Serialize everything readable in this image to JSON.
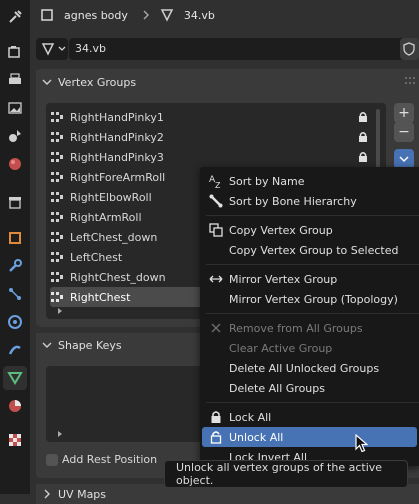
{
  "header": {
    "object_name": "agnes body",
    "mesh_name": "34.vb"
  },
  "toolbar": {
    "data_name": "34.vb"
  },
  "vertex_groups": {
    "title": "Vertex Groups",
    "items": [
      {
        "label": "RightHandPinky1",
        "locked": true
      },
      {
        "label": "RightHandPinky2",
        "locked": true
      },
      {
        "label": "RightHandPinky3",
        "locked": true
      },
      {
        "label": "RightForeArmRoll",
        "locked": false
      },
      {
        "label": "RightElbowRoll",
        "locked": false
      },
      {
        "label": "RightArmRoll",
        "locked": false
      },
      {
        "label": "LeftChest_down",
        "locked": false
      },
      {
        "label": "LeftChest",
        "locked": false
      },
      {
        "label": "RightChest_down",
        "locked": false
      },
      {
        "label": "RightChest",
        "locked": false
      }
    ],
    "add_label": "+",
    "remove_label": "−"
  },
  "shape_keys": {
    "title": "Shape Keys",
    "add_rest_position": "Add Rest Position"
  },
  "uv_maps": {
    "title": "UV Maps"
  },
  "context_menu": {
    "sort_by_name": "Sort by Name",
    "sort_by_bone": "Sort by Bone Hierarchy",
    "copy_group": "Copy Vertex Group",
    "copy_to_selected": "Copy Vertex Group to Selected",
    "mirror_group": "Mirror Vertex Group",
    "mirror_topology": "Mirror Vertex Group (Topology)",
    "remove_from_all": "Remove from All Groups",
    "clear_active": "Clear Active Group",
    "delete_unlocked": "Delete All Unlocked Groups",
    "delete_all": "Delete All Groups",
    "lock_all": "Lock All",
    "unlock_all": "Unlock All",
    "lock_invert": "Lock Invert All"
  },
  "tooltip": {
    "text": "Unlock all vertex groups of the active object."
  },
  "colors": {
    "highlight": "#4772b3",
    "data_tab_green": "#5dbd7e",
    "background": "#303030"
  }
}
